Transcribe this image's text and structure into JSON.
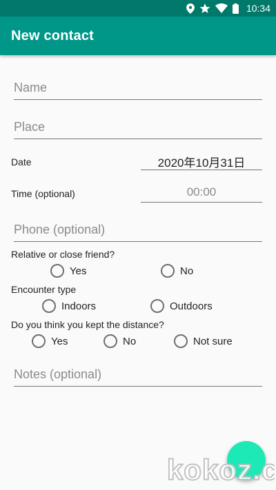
{
  "status_bar": {
    "icons": [
      "location-icon",
      "star-icon",
      "wifi-icon",
      "battery-icon"
    ],
    "time": "10:34"
  },
  "app_bar": {
    "title": "New contact"
  },
  "form": {
    "name": {
      "placeholder": "Name"
    },
    "place": {
      "placeholder": "Place"
    },
    "date": {
      "label": "Date",
      "value": "2020年10月31日"
    },
    "time": {
      "label": "Time (optional)",
      "placeholder": "00:00"
    },
    "phone": {
      "placeholder": "Phone (optional)"
    },
    "relative": {
      "question": "Relative or close friend?",
      "options": [
        "Yes",
        "No"
      ]
    },
    "encounter": {
      "question": "Encounter type",
      "options": [
        "Indoors",
        "Outdoors"
      ]
    },
    "distance": {
      "question": "Do you think you kept the distance?",
      "options": [
        "Yes",
        "No",
        "Not sure"
      ]
    },
    "notes": {
      "placeholder": "Notes (optional)"
    }
  },
  "colors": {
    "status_bar": "#00796b",
    "app_bar": "#009688",
    "fab": "#1de9b6"
  },
  "watermark": {
    "text": "kokoz.com"
  }
}
